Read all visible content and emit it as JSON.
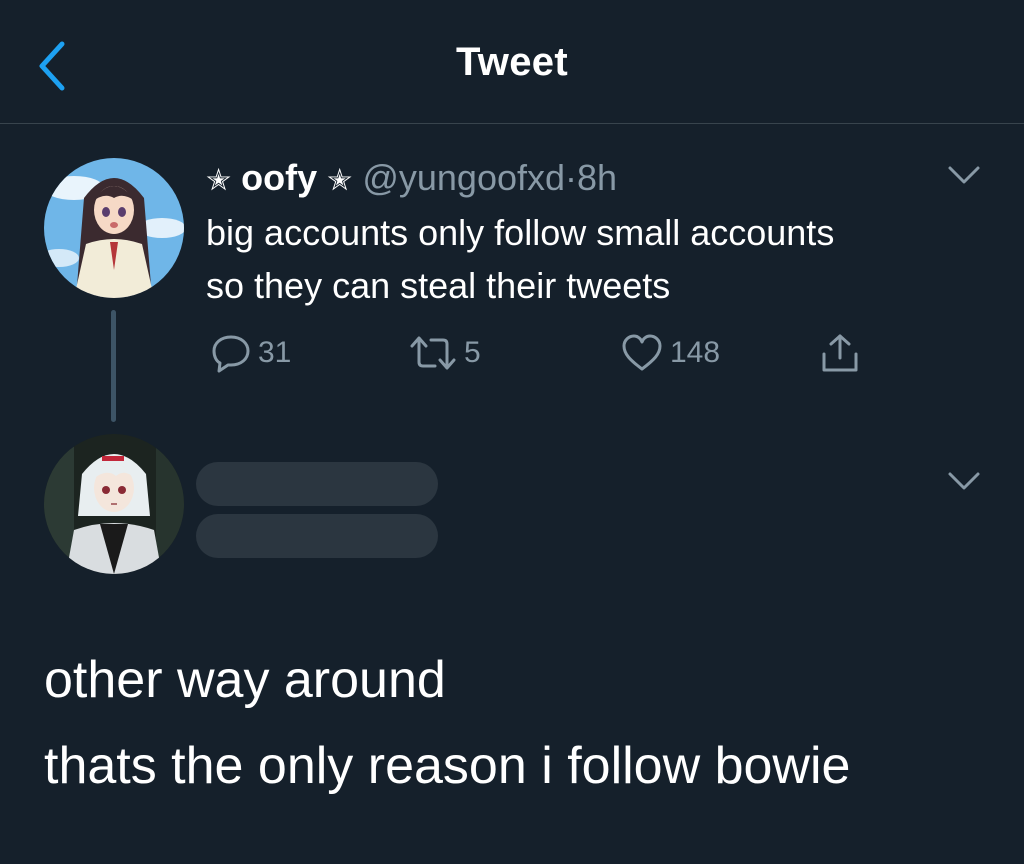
{
  "header": {
    "title": "Tweet",
    "back_icon": "chevron-left-icon",
    "accent_color": "#1da1f2"
  },
  "tweet": {
    "name_prefix": "✭",
    "display_name": "oofy",
    "name_suffix": "✭",
    "handle": "@yungoofxd",
    "separator": "·",
    "time": "8h",
    "text_line1": "big accounts only follow small accounts",
    "text_line2": "so they can steal their tweets",
    "actions": {
      "reply_count": "31",
      "retweet_count": "5",
      "like_count": "148"
    }
  },
  "reply": {
    "line1": "other way around",
    "line2": "thats the only reason i follow bowie"
  },
  "colors": {
    "background": "#15202b",
    "secondary_text": "#8899a6",
    "divider": "#38444d",
    "redacted_bar": "#2b3640"
  }
}
